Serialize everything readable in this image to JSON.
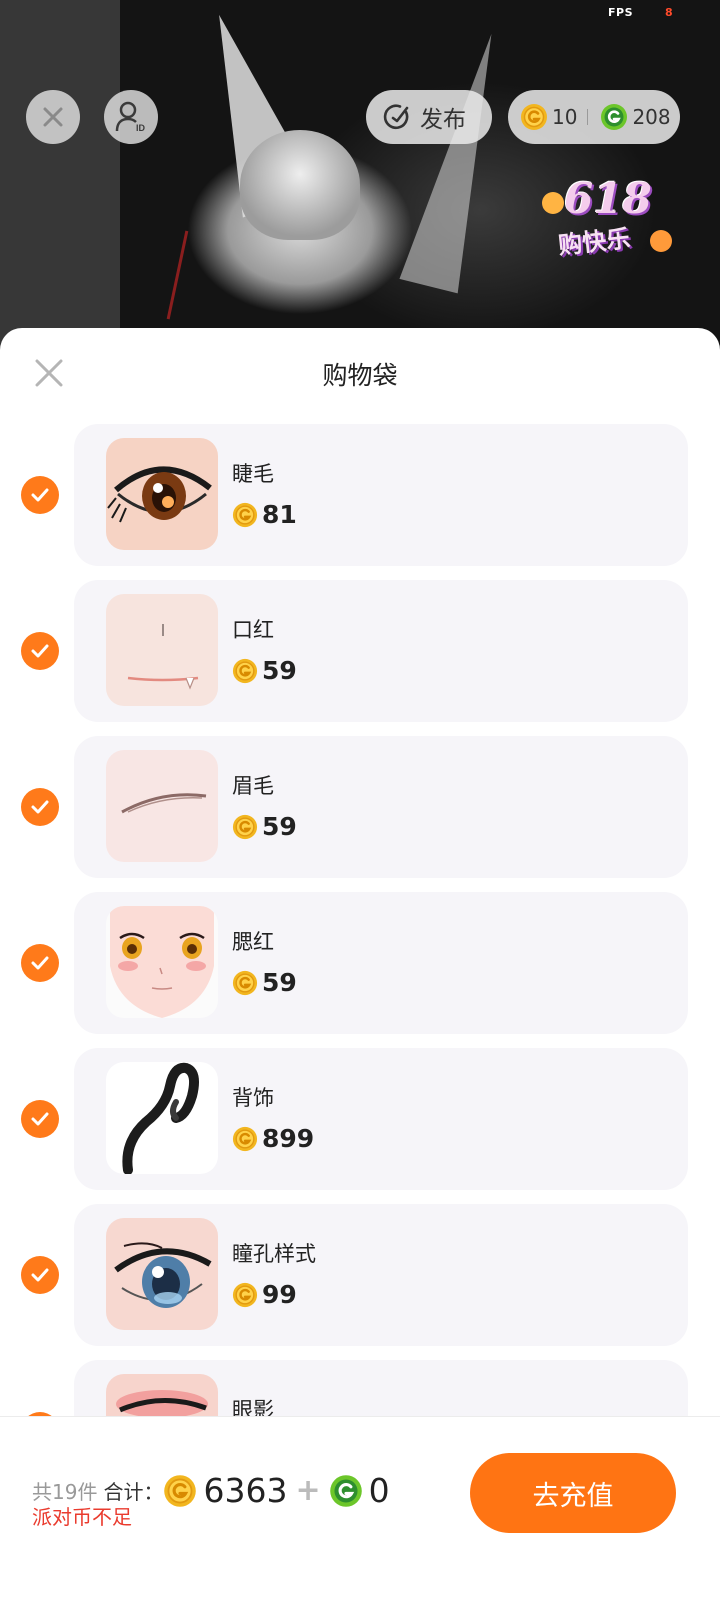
{
  "status": {
    "fps_label": "FPS",
    "fps_value": "8"
  },
  "topbar": {
    "publish_label": "发布",
    "party_coin_balance": "10",
    "g_coin_balance": "208"
  },
  "promo": {
    "badge_number": "618",
    "badge_text": "购快乐"
  },
  "sheet": {
    "title": "购物袋",
    "items": [
      {
        "name": "睫毛",
        "price": "81",
        "checked": true,
        "icon": "eyelash-thumbnail"
      },
      {
        "name": "口红",
        "price": "59",
        "checked": true,
        "icon": "lipstick-thumbnail"
      },
      {
        "name": "眉毛",
        "price": "59",
        "checked": true,
        "icon": "eyebrow-thumbnail"
      },
      {
        "name": "腮红",
        "price": "59",
        "checked": true,
        "icon": "blush-thumbnail"
      },
      {
        "name": "背饰",
        "price": "899",
        "checked": true,
        "icon": "back-accessory-thumbnail"
      },
      {
        "name": "瞳孔样式",
        "price": "99",
        "checked": true,
        "icon": "pupil-thumbnail"
      },
      {
        "name": "眼影",
        "price": "",
        "checked": true,
        "icon": "eyeshadow-thumbnail"
      }
    ]
  },
  "footer": {
    "count_text": "共19件",
    "total_label": "合计：",
    "party_coin_total": "6363",
    "plus": "+",
    "g_coin_total": "0",
    "warning": "派对币不足",
    "recharge_label": "去充值"
  },
  "colors": {
    "accent": "#ff7413",
    "warning": "#ea3b2e",
    "gold_coin": "#f2b61f",
    "green_coin": "#6cc62a"
  }
}
